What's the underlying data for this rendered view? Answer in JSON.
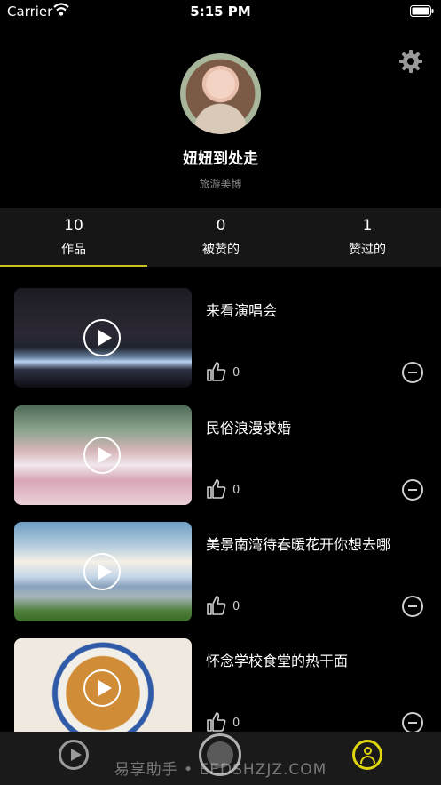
{
  "status_bar": {
    "carrier": "Carrier",
    "time": "5:15 PM"
  },
  "profile": {
    "username": "妞妞到处走",
    "tagline": "旅游美博"
  },
  "stats": [
    {
      "value": "10",
      "label": "作品"
    },
    {
      "value": "0",
      "label": "被赞的"
    },
    {
      "value": "1",
      "label": "赞过的"
    }
  ],
  "videos": [
    {
      "title": "来看演唱会",
      "likes": "0"
    },
    {
      "title": "民俗浪漫求婚",
      "likes": "0"
    },
    {
      "title": "美景南湾待春暖花开你想去哪",
      "likes": "0"
    },
    {
      "title": "怀念学校食堂的热干面",
      "likes": "0"
    }
  ],
  "watermark": "易享助手 • EEDSHZJZ.COM",
  "accent_color": "#e0d60e"
}
